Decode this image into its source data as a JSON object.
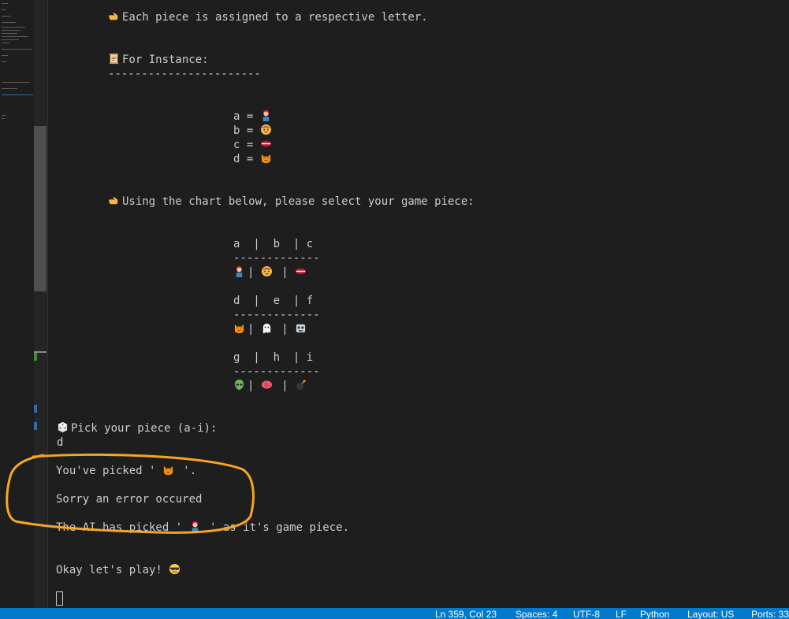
{
  "terminal": {
    "line_each_piece": "Each piece is assigned to a respective letter.",
    "line_for_instance": "For Instance:",
    "line_dashes": "-----------------------",
    "examples": [
      {
        "text": "a = ",
        "emoji": "person-red-hair"
      },
      {
        "text": "b = ",
        "emoji": "child-face"
      },
      {
        "text": "c = ",
        "emoji": "lips"
      },
      {
        "text": "d = ",
        "emoji": "cat-heart-eyes"
      }
    ],
    "line_using_chart": "Using the chart below, please select your game piece:",
    "chart_rows": [
      {
        "header": "a  |  b  | c",
        "divider": "-------------",
        "emojis": [
          "person-red-hair",
          "child-face",
          "lips"
        ]
      },
      {
        "header": "d  |  e  | f",
        "divider": "-------------",
        "emojis": [
          "cat-heart-eyes",
          "ghost",
          "robot"
        ]
      },
      {
        "header": "g  |  h  | i",
        "divider": "-------------",
        "emojis": [
          "alien",
          "brain",
          "bomb"
        ]
      }
    ],
    "line_pick": "Pick your piece (a-i):",
    "input_value": "d",
    "line_you_picked_pre": "You've picked ' ",
    "line_you_picked_post": " '.",
    "line_error": "Sorry an error occured",
    "line_ai_pre": "The AI has picked ' ",
    "line_ai_post": " ' as it's game piece.",
    "line_play": "Okay let's play! "
  },
  "statusbar": {
    "ln_col": "Ln 359, Col 23",
    "spaces": "Spaces: 4",
    "encoding": "UTF-8",
    "eol": "LF",
    "language": "Python",
    "layout": "Layout: US",
    "ports": "Ports: 33"
  },
  "colors": {
    "background": "#1e1e1e",
    "text": "#cccccc",
    "statusbar": "#007acc",
    "annotation": "#f5a623"
  }
}
